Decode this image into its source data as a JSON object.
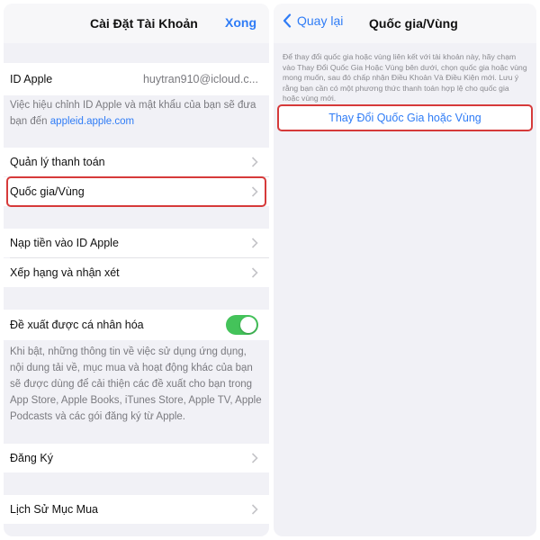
{
  "left_screen": {
    "title": "Cài Đặt Tài Khoản",
    "done_label": "Xong",
    "apple_id": {
      "label": "ID Apple",
      "value": "huytran910@icloud.c..."
    },
    "apple_id_note": "Việc hiệu chỉnh ID Apple và mật khẩu của bạn sẽ đưa bạn đến",
    "apple_id_link": "appleid.apple.com",
    "items": [
      {
        "label": "Quản lý thanh toán"
      },
      {
        "label": "Quốc gia/Vùng"
      },
      {
        "label": "Nạp tiền vào ID Apple"
      },
      {
        "label": "Xếp hạng và nhận xét"
      }
    ],
    "personalized": {
      "label": "Đề xuất được cá nhân hóa",
      "on": true
    },
    "personalized_note": "Khi bật, những thông tin về việc sử dụng ứng dụng, nội dung tải về, mục mua và hoạt động khác của bạn sẽ được dùng để cải thiện các đề xuất cho bạn trong App Store, Apple Books, iTunes Store, Apple TV, Apple Podcasts và các gói đăng ký từ Apple.",
    "subscriptions_label": "Đăng Ký",
    "history_label": "Lịch Sử Mục Mua"
  },
  "right_screen": {
    "back_label": "Quay lại",
    "title": "Quốc gia/Vùng",
    "description": "Để thay đổi quốc gia hoặc vùng liên kết với tài khoản này, hãy chạm vào Thay Đổi Quốc Gia Hoặc Vùng bên dưới, chọn quốc gia hoặc vùng mong muốn, sau đó chấp nhận Điều Khoản Và Điều Kiện mới. Lưu ý rằng bạn cần có một phương thức thanh toán hợp lệ cho quốc gia hoặc vùng mới.",
    "change_button": "Thay Đổi Quốc Gia hoặc Vùng"
  },
  "colors": {
    "accent": "#2f7cf6",
    "highlight": "#d63a3a",
    "toggle_on": "#44c35a",
    "background": "#f1f1f6"
  },
  "icons": [
    "chevron-right-icon",
    "chevron-left-icon"
  ]
}
